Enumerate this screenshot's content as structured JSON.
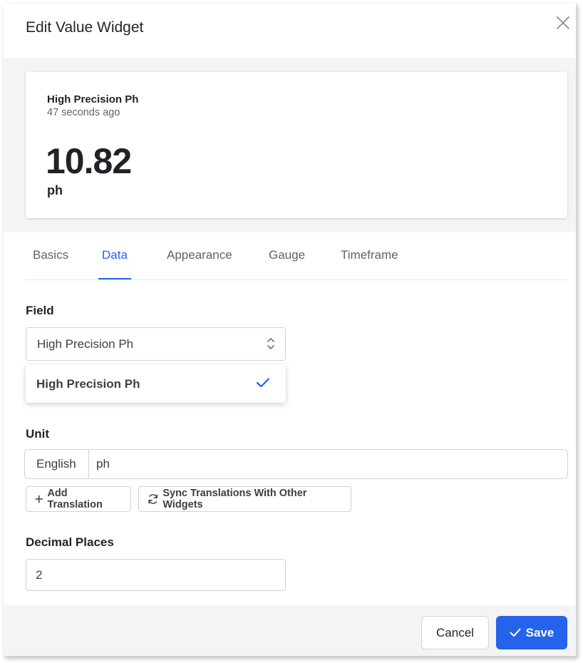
{
  "dialog": {
    "title": "Edit Value Widget"
  },
  "preview": {
    "field_name": "High Precision Ph",
    "timestamp": "47 seconds ago",
    "value": "10.82",
    "unit": "ph"
  },
  "tabs": [
    {
      "label": "Basics",
      "active": false
    },
    {
      "label": "Data",
      "active": true
    },
    {
      "label": "Appearance",
      "active": false
    },
    {
      "label": "Gauge",
      "active": false
    },
    {
      "label": "Timeframe",
      "active": false
    }
  ],
  "field": {
    "label": "Field",
    "selected": "High Precision Ph",
    "options": [
      {
        "label": "High Precision Ph",
        "selected": true
      }
    ]
  },
  "unit": {
    "label": "Unit",
    "language": "English",
    "value": "ph",
    "add_translation_label": "Add Translation",
    "sync_label": "Sync Translations With Other Widgets"
  },
  "decimal_places": {
    "label": "Decimal Places",
    "value": "2"
  },
  "footer": {
    "cancel_label": "Cancel",
    "save_label": "Save"
  },
  "colors": {
    "accent": "#2563eb",
    "panel_bg": "#f3f4f6",
    "border": "#cfd3d8"
  },
  "icons": {
    "close": "close-icon",
    "select": "chevron-up-down-icon",
    "check": "check-icon",
    "add": "plus-icon",
    "sync": "sync-icon"
  }
}
